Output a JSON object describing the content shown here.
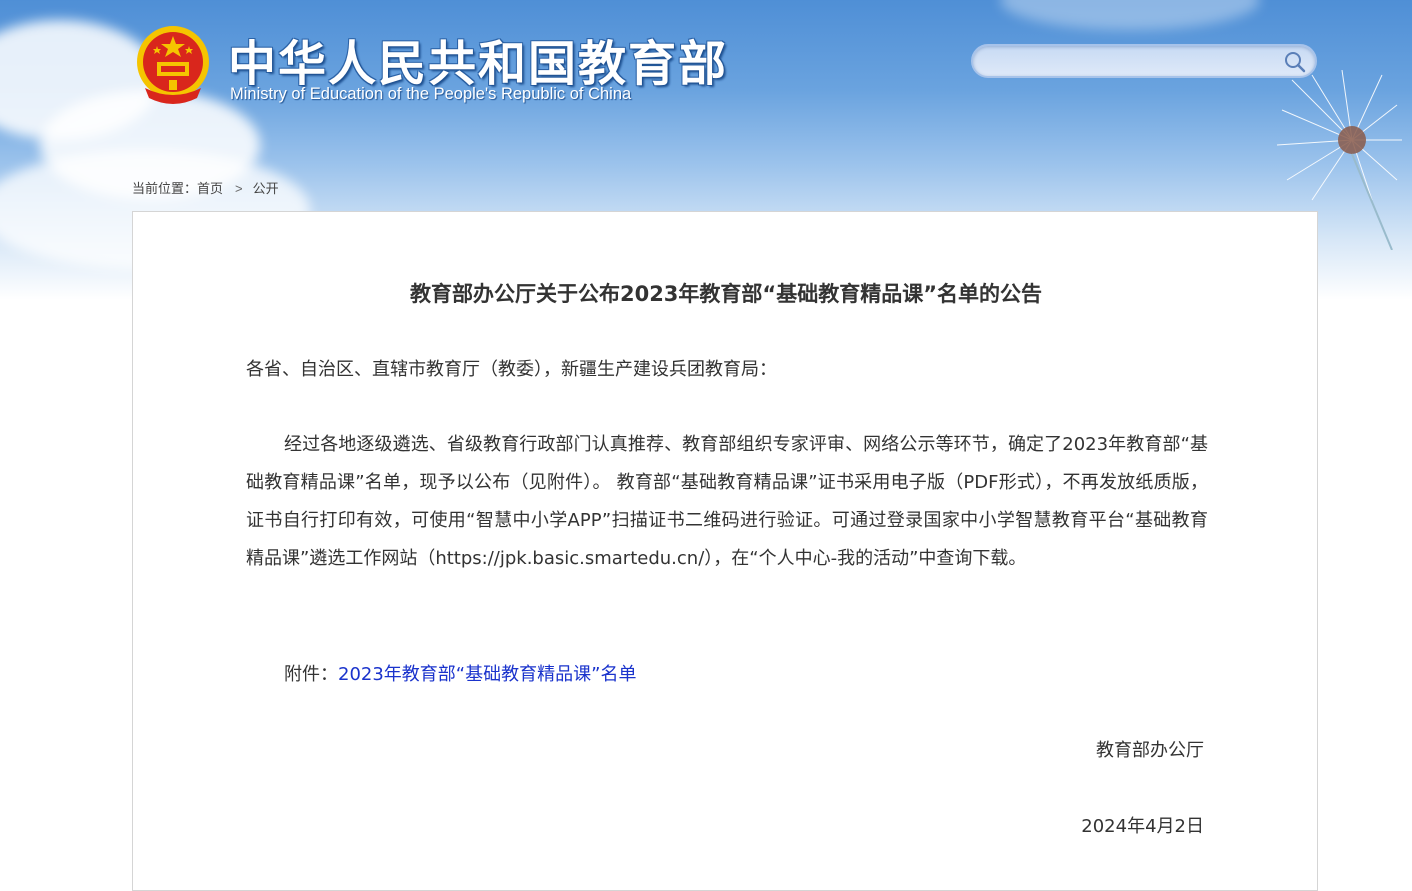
{
  "header": {
    "site_title_cn": "中华人民共和国教育部",
    "site_title_en": "Ministry of Education of the People's Republic of China",
    "search": {
      "value": "",
      "placeholder": ""
    },
    "colors": {
      "banner_blue": "#4f8fd6",
      "emblem_red": "#d9261c",
      "emblem_gold": "#f5c400"
    }
  },
  "breadcrumb": {
    "label": "当前位置：",
    "items": [
      "首页",
      "公开"
    ],
    "separator": ">"
  },
  "article": {
    "title": "教育部办公厅关于公布2023年教育部“基础教育精品课”名单的公告",
    "salutation": "各省、自治区、直辖市教育厅（教委），新疆生产建设兵团教育局：",
    "paragraph": "经过各地逐级遴选、省级教育行政部门认真推荐、教育部组织专家评审、网络公示等环节，确定了2023年教育部“基础教育精品课”名单，现予以公布（见附件）。 教育部“基础教育精品课”证书采用电子版（PDF形式），不再发放纸质版，证书自行打印有效，可使用“智慧中小学APP”扫描证书二维码进行验证。可通过登录国家中小学智慧教育平台“基础教育精品课”遴选工作网站（https://jpk.basic.smartedu.cn/），在“个人中心-我的活动”中查询下载。",
    "attachment_label": "附件：",
    "attachment_link": "2023年教育部“基础教育精品课”名单",
    "link_color": "#1a33cc",
    "signature": "教育部办公厅",
    "date": "2024年4月2日"
  }
}
